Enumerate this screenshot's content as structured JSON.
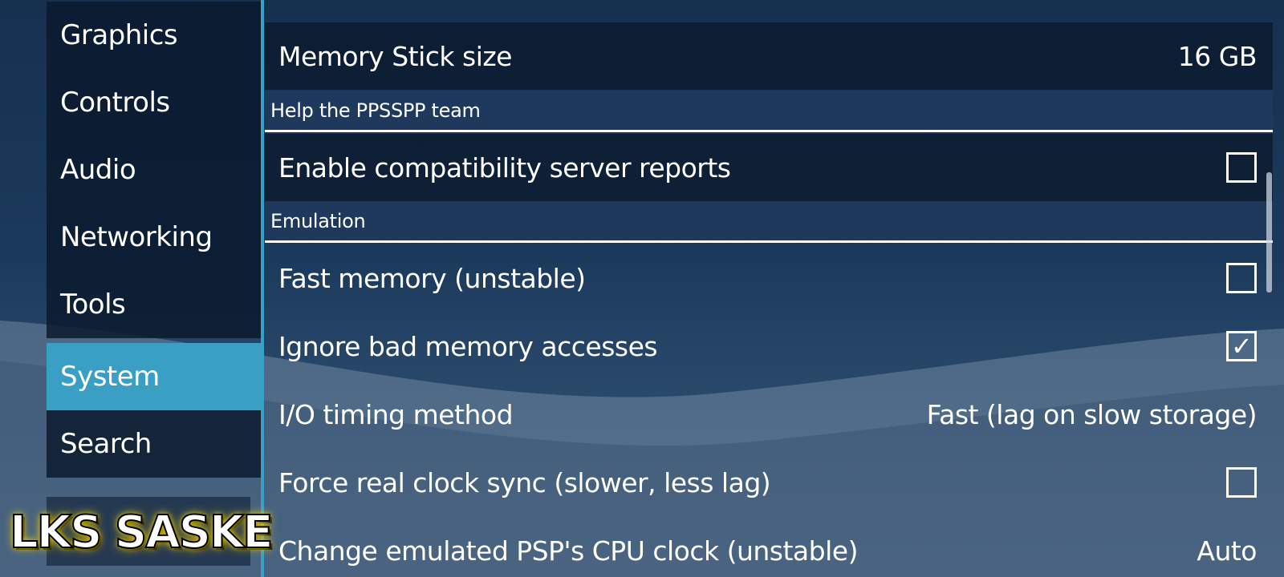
{
  "sidebar": {
    "items": [
      {
        "label": "Graphics",
        "selected": false
      },
      {
        "label": "Controls",
        "selected": false
      },
      {
        "label": "Audio",
        "selected": false
      },
      {
        "label": "Networking",
        "selected": false
      },
      {
        "label": "Tools",
        "selected": false
      },
      {
        "label": "System",
        "selected": true
      },
      {
        "label": "Search",
        "selected": false
      }
    ]
  },
  "settings": {
    "memory_stick_size": {
      "label": "Memory Stick size",
      "value": "16 GB"
    },
    "section_help": {
      "label": "Help the PPSSPP team"
    },
    "compat_reports": {
      "label": "Enable compatibility server reports",
      "checked": false
    },
    "section_emulation": {
      "label": "Emulation"
    },
    "fast_memory": {
      "label": "Fast memory (unstable)",
      "checked": false
    },
    "ignore_bad_memory": {
      "label": "Ignore bad memory accesses",
      "checked": true
    },
    "io_timing": {
      "label": "I/O timing method",
      "value": "Fast (lag on slow storage)"
    },
    "force_clock_sync": {
      "label": "Force real clock sync (slower, less lag)",
      "checked": false
    },
    "cpu_clock": {
      "label": "Change emulated PSP's CPU clock (unstable)",
      "value": "Auto"
    }
  },
  "checkmark_glyph": "✓",
  "watermark": {
    "text": "LKS SASKE"
  },
  "colors": {
    "accent": "#3a9fc4",
    "panel": "#0a182c",
    "header": "#1e3a5c",
    "watermark_glow": "#e8c800"
  }
}
